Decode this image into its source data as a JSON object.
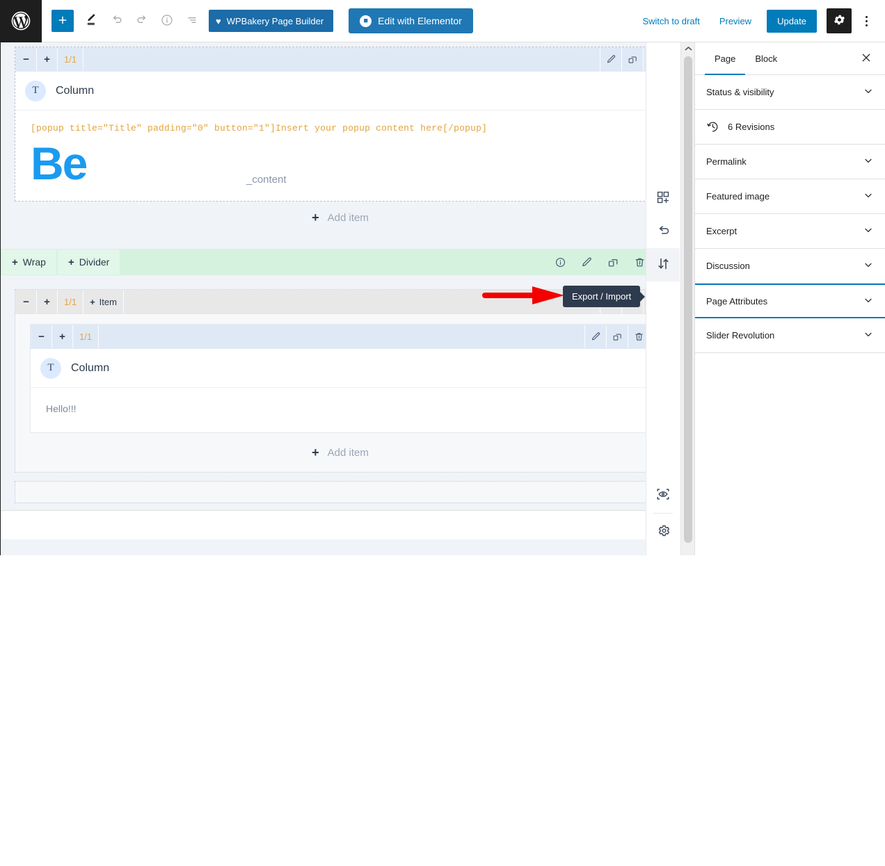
{
  "topbar": {
    "logo_icon": "wordpress-logo-icon",
    "add_block_label": "+",
    "add_block_icon": "plus-icon",
    "tools_icon": "pencil-tools-icon",
    "undo_icon": "undo-arrow-icon",
    "redo_icon": "redo-arrow-icon",
    "details_icon": "info-circle-icon",
    "list_view_icon": "list-view-icon",
    "wpbakery_label": "WPBakery Page Builder",
    "wpbakery_icon": "heart-icon",
    "elementor_label": "Edit with Elementor",
    "elementor_icon": "elementor-badge-icon",
    "switch_to_draft_label": "Switch to draft",
    "preview_label": "Preview",
    "update_label": "Update",
    "settings_icon": "gear-icon",
    "options_icon": "kebab-menu-icon"
  },
  "canvas": {
    "section1": {
      "toolbar": {
        "minus": "−",
        "plus": "+",
        "fraction": "1/1",
        "icons": [
          "pencil-icon",
          "duplicate-icon",
          "trash-icon"
        ]
      },
      "column": {
        "avatar_letter": "T",
        "title": "Column",
        "shortcode": "[popup title=\"Title\" padding=\"0\" button=\"1\"]Insert your popup content here[/popup]",
        "logo_text": "Be",
        "content_text": "_content"
      },
      "add_item": {
        "plus": "+",
        "label": "Add item"
      }
    },
    "wrap_bar": {
      "wrap_label": "Wrap",
      "divider_label": "Divider",
      "plus": "+",
      "icons": [
        "info-circle-icon",
        "pencil-icon",
        "duplicate-icon",
        "trash-icon",
        "kebab-menu-icon"
      ]
    },
    "section2": {
      "outer_toolbar": {
        "minus": "−",
        "plus": "+",
        "fraction": "1/1",
        "item_plus": "+",
        "item_label": "Item",
        "icons": [
          "pencil-icon",
          "duplicate-icon",
          "trash-icon"
        ]
      },
      "inner_toolbar": {
        "minus": "−",
        "plus": "+",
        "fraction": "1/1",
        "icons": [
          "pencil-icon",
          "duplicate-icon",
          "trash-icon"
        ]
      },
      "column": {
        "avatar_letter": "T",
        "title": "Column",
        "body_text": "Hello!!!"
      },
      "add_item": {
        "plus": "+",
        "label": "Add item"
      }
    },
    "tooltip": {
      "label": "Export / Import",
      "arrow_icon": "red-pointer-arrow-icon"
    }
  },
  "rail": {
    "items": [
      {
        "icon": "add-layout-icon",
        "active": false
      },
      {
        "icon": "undo-icon",
        "active": false
      },
      {
        "icon": "export-import-icon",
        "active": true
      }
    ],
    "bottom_items": [
      {
        "icon": "preview-eye-icon",
        "active": false
      },
      {
        "icon": "gear-icon",
        "active": false
      }
    ]
  },
  "scrollbar": {
    "up_arrow_icon": "scroll-up-arrow-icon"
  },
  "sidebar": {
    "tabs": [
      {
        "label": "Page",
        "active": true
      },
      {
        "label": "Block",
        "active": false
      }
    ],
    "close_icon": "close-icon",
    "panels": [
      {
        "label": "Status & visibility",
        "icon": "chevron-down-icon",
        "highlight": false,
        "kind": "accordion"
      },
      {
        "label": "6 Revisions",
        "icon": "revisions-clock-icon",
        "highlight": false,
        "kind": "link"
      },
      {
        "label": "Permalink",
        "icon": "chevron-down-icon",
        "highlight": false,
        "kind": "accordion"
      },
      {
        "label": "Featured image",
        "icon": "chevron-down-icon",
        "highlight": false,
        "kind": "accordion"
      },
      {
        "label": "Excerpt",
        "icon": "chevron-down-icon",
        "highlight": false,
        "kind": "accordion"
      },
      {
        "label": "Discussion",
        "icon": "chevron-down-icon",
        "highlight": false,
        "kind": "accordion"
      },
      {
        "label": "Page Attributes",
        "icon": "chevron-down-icon",
        "highlight": true,
        "kind": "accordion"
      },
      {
        "label": "Slider Revolution",
        "icon": "chevron-down-icon",
        "highlight": false,
        "kind": "accordion"
      }
    ]
  },
  "colors": {
    "wp_blue": "#007cba",
    "elementor_blue": "#1f78b4",
    "wpbakery_blue": "#1b6ca8",
    "be_logo_blue": "#1a9bf0",
    "shortcode_orange": "#e3a33c",
    "fraction_orange": "#e8a33d",
    "tooltip_navy": "#2e3b4e",
    "arrow_red": "#f40000",
    "green_bar": "#d5f2df",
    "blue_toolbar": "#dfe9f6",
    "gray_toolbar": "#e8e8e8",
    "canvas_bg": "#f0f3f7",
    "highlight_border": "#0f7bb5"
  }
}
